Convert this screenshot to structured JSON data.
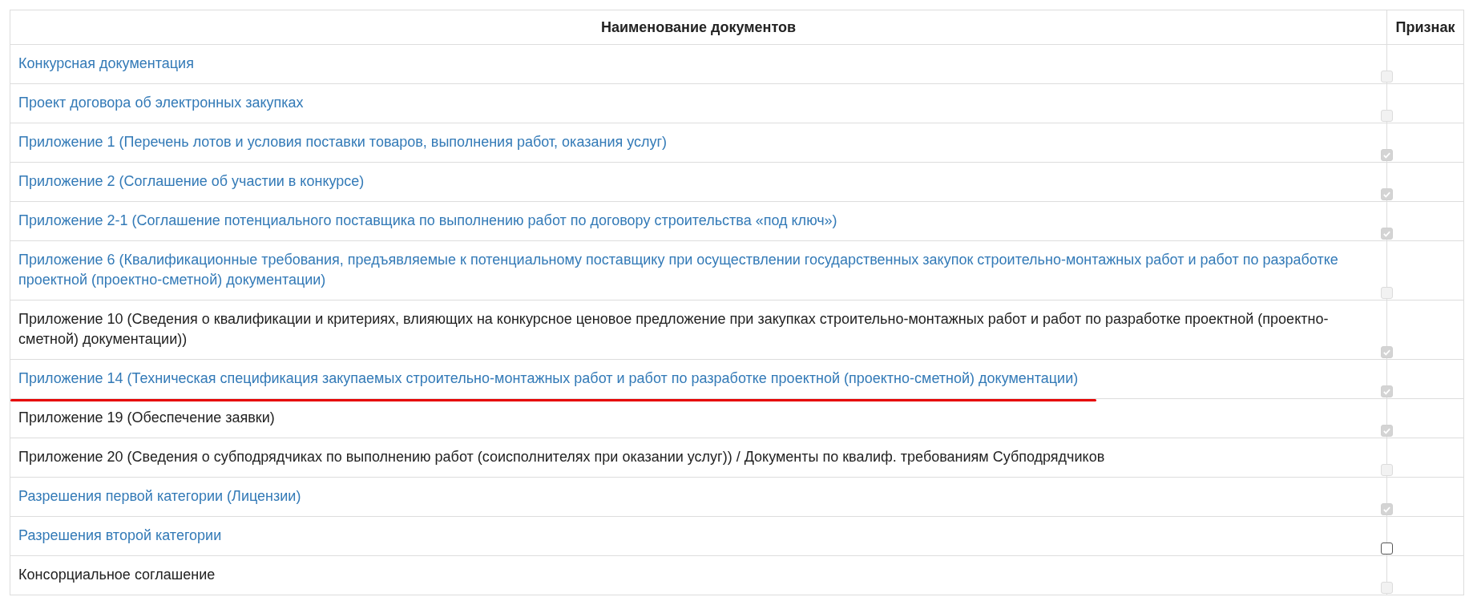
{
  "table": {
    "columns": [
      "Наименование документов",
      "Признак"
    ],
    "rows": [
      {
        "name": "Конкурсная документация",
        "kind": "link",
        "checked": false,
        "disabled": true,
        "marked": false
      },
      {
        "name": "Проект договора об электронных закупках",
        "kind": "link",
        "checked": false,
        "disabled": true,
        "marked": false
      },
      {
        "name": "Приложение 1 (Перечень лотов и условия поставки товаров, выполнения работ, оказания услуг)",
        "kind": "link",
        "checked": true,
        "disabled": true,
        "marked": false
      },
      {
        "name": "Приложение 2 (Соглашение об участии в конкурсе)",
        "kind": "link",
        "checked": true,
        "disabled": true,
        "marked": false
      },
      {
        "name": "Приложение 2-1 (Соглашение потенциального поставщика по выполнению работ по договору строительства «под ключ»)",
        "kind": "link",
        "checked": true,
        "disabled": true,
        "marked": false
      },
      {
        "name": "Приложение 6 (Квалификационные требования, предъявляемые к потенциальному поставщику при осуществлении государственных закупок строительно-монтажных работ и работ по разработке проектной (проектно-сметной) документации)",
        "kind": "link",
        "checked": false,
        "disabled": true,
        "marked": false
      },
      {
        "name": "Приложение 10 (Сведения о квалификации и критериях, влияющих на конкурсное ценовое предложение при закупках строительно-монтажных работ и работ по разработке проектной (проектно-сметной) документации))",
        "kind": "text",
        "checked": true,
        "disabled": true,
        "marked": false
      },
      {
        "name": "Приложение 14 (Техническая спецификация закупаемых строительно-монтажных работ и работ по разработке проектной (проектно-сметной) документации)",
        "kind": "link",
        "checked": true,
        "disabled": true,
        "marked": true
      },
      {
        "name": "Приложение 19 (Обеспечение заявки)",
        "kind": "text",
        "checked": true,
        "disabled": true,
        "marked": false
      },
      {
        "name": "Приложение 20 (Сведения о субподрядчиках по выполнению работ (соисполнителях при оказании услуг)) / Документы по квалиф. требованиям Субподрядчиков",
        "kind": "text",
        "checked": false,
        "disabled": true,
        "marked": false
      },
      {
        "name": "Разрешения первой категории (Лицензии)",
        "kind": "link",
        "checked": true,
        "disabled": true,
        "marked": false
      },
      {
        "name": "Разрешения второй категории",
        "kind": "link",
        "checked": false,
        "disabled": false,
        "marked": false
      },
      {
        "name": "Консорциальное соглашение",
        "kind": "text",
        "checked": false,
        "disabled": true,
        "marked": false
      }
    ]
  }
}
